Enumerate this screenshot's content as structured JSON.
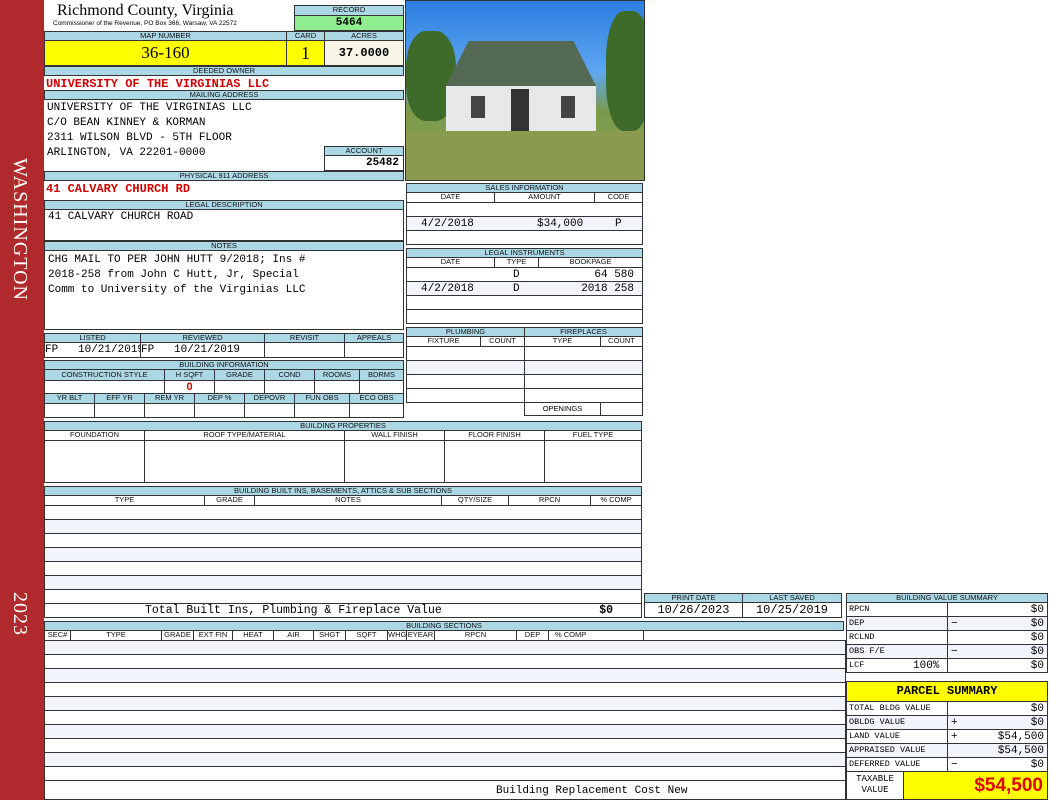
{
  "sidebar": {
    "district": "WASHINGTON",
    "year": "2023"
  },
  "header": {
    "county": "Richmond County, Virginia",
    "subtitle": "Commissioner of the Revenue, PO Box 366, Warsaw, VA 22572",
    "record_label": "RECORD",
    "record": "5464"
  },
  "parcel": {
    "map_label": "MAP NUMBER",
    "map_number": "36-160",
    "card_label": "CARD",
    "card": "1",
    "acres_label": "ACRES",
    "acres": "37.0000"
  },
  "owner": {
    "label": "DEEDED OWNER",
    "name": "UNIVERSITY OF THE VIRGINIAS LLC"
  },
  "mailing": {
    "label": "MAILING ADDRESS",
    "lines": [
      "UNIVERSITY OF THE VIRGINIAS LLC",
      "C/O BEAN KINNEY & KORMAN",
      "2311 WILSON BLVD - 5TH FLOOR",
      "ARLINGTON, VA 22201-0000"
    ],
    "account_label": "ACCOUNT",
    "account": "25482"
  },
  "physical": {
    "label": "PHYSICAL 911 ADDRESS",
    "address": "41 CALVARY CHURCH RD"
  },
  "legal": {
    "label": "LEGAL DESCRIPTION",
    "text": "41 CALVARY CHURCH ROAD"
  },
  "notes": {
    "label": "NOTES",
    "lines": [
      "CHG MAIL TO PER JOHN HUTT 9/2018; Ins #",
      "2018-258 from John C Hutt, Jr, Special",
      "Comm to University of the Virginias LLC"
    ]
  },
  "listing": {
    "listed_label": "LISTED",
    "listed": "FP   10/21/2019",
    "reviewed_label": "REVIEWED",
    "reviewed": "FP   10/21/2019",
    "revisit_label": "REVISIT",
    "appeals_label": "APPEALS"
  },
  "building_info": {
    "label": "BUILDING INFORMATION",
    "cols1": [
      "CONSTRUCTION STYLE",
      "H SQFT",
      "GRADE",
      "COND",
      "ROOMS",
      "BDRMS"
    ],
    "hsqft": "0",
    "cols2": [
      "YR BLT",
      "EFF YR",
      "REM YR",
      "DEP %",
      "DEPOVR",
      "FUN OBS",
      "ECO OBS"
    ]
  },
  "sales": {
    "label": "SALES INFORMATION",
    "cols": [
      "DATE",
      "AMOUNT",
      "CODE"
    ],
    "rows": [
      {
        "date": "4/2/2018",
        "amount": "$34,000",
        "code": "P"
      }
    ]
  },
  "instruments": {
    "label": "LEGAL INSTRUMENTS",
    "cols": [
      "DATE",
      "TYPE",
      "BOOKPAGE"
    ],
    "rows": [
      {
        "date": "",
        "type": "D",
        "bookpage": "64 580"
      },
      {
        "date": "4/2/2018",
        "type": "D",
        "bookpage": "2018 258"
      }
    ]
  },
  "plumbing": {
    "label": "PLUMBING",
    "cols": [
      "FIXTURE",
      "COUNT"
    ]
  },
  "fireplaces": {
    "label": "FIREPLACES",
    "cols": [
      "TYPE",
      "COUNT"
    ],
    "openings_label": "OPENINGS"
  },
  "properties": {
    "label": "BUILDING PROPERTIES",
    "cols": [
      "FOUNDATION",
      "ROOF TYPE/MATERIAL",
      "WALL FINISH",
      "FLOOR FINISH",
      "FUEL TYPE"
    ]
  },
  "builtins": {
    "label": "BUILDING BUILT INS, BASEMENTS, ATTICS & SUB SECTIONS",
    "cols": [
      "TYPE",
      "GRADE",
      "NOTES",
      "QTY/SIZE",
      "RPCN",
      "% COMP"
    ],
    "total_label": "Total Built Ins, Plumbing & Fireplace Value",
    "total": "$0"
  },
  "dates": {
    "print_label": "PRINT DATE",
    "print": "10/26/2023",
    "saved_label": "LAST SAVED",
    "saved": "10/25/2019"
  },
  "sections": {
    "label": "BUILDING SECTIONS",
    "cols": [
      "SEC#",
      "TYPE",
      "GRADE",
      "EXT FIN",
      "HEAT",
      "AIR",
      "SHGT",
      "SQFT",
      "WHGT",
      "EYEAR",
      "RPCN",
      "DEP",
      "% COMP"
    ],
    "footer": "Building Replacement Cost New"
  },
  "value_summary": {
    "label": "BUILDING VALUE SUMMARY",
    "rows": [
      {
        "label": "RPCN",
        "sign": "",
        "value": "$0"
      },
      {
        "label": "DEP",
        "sign": "−",
        "value": "$0"
      },
      {
        "label": "RCLND",
        "sign": "",
        "value": "$0"
      },
      {
        "label": "OBS F/E",
        "sign": "−",
        "value": "$0"
      },
      {
        "label": "LCF",
        "pct": "100%",
        "sign": "",
        "value": "$0"
      }
    ]
  },
  "parcel_summary": {
    "label": "PARCEL SUMMARY",
    "rows": [
      {
        "label": "TOTAL BLDG VALUE",
        "sign": "",
        "value": "$0"
      },
      {
        "label": "OBLDG VALUE",
        "sign": "+",
        "value": "$0"
      },
      {
        "label": "LAND VALUE",
        "sign": "+",
        "value": "$54,500"
      },
      {
        "label": "APPRAISED VALUE",
        "sign": "",
        "value": "$54,500"
      },
      {
        "label": "DEFERRED VALUE",
        "sign": "−",
        "value": "$0"
      }
    ],
    "taxable_label": "TAXABLE VALUE",
    "taxable": "$54,500"
  }
}
